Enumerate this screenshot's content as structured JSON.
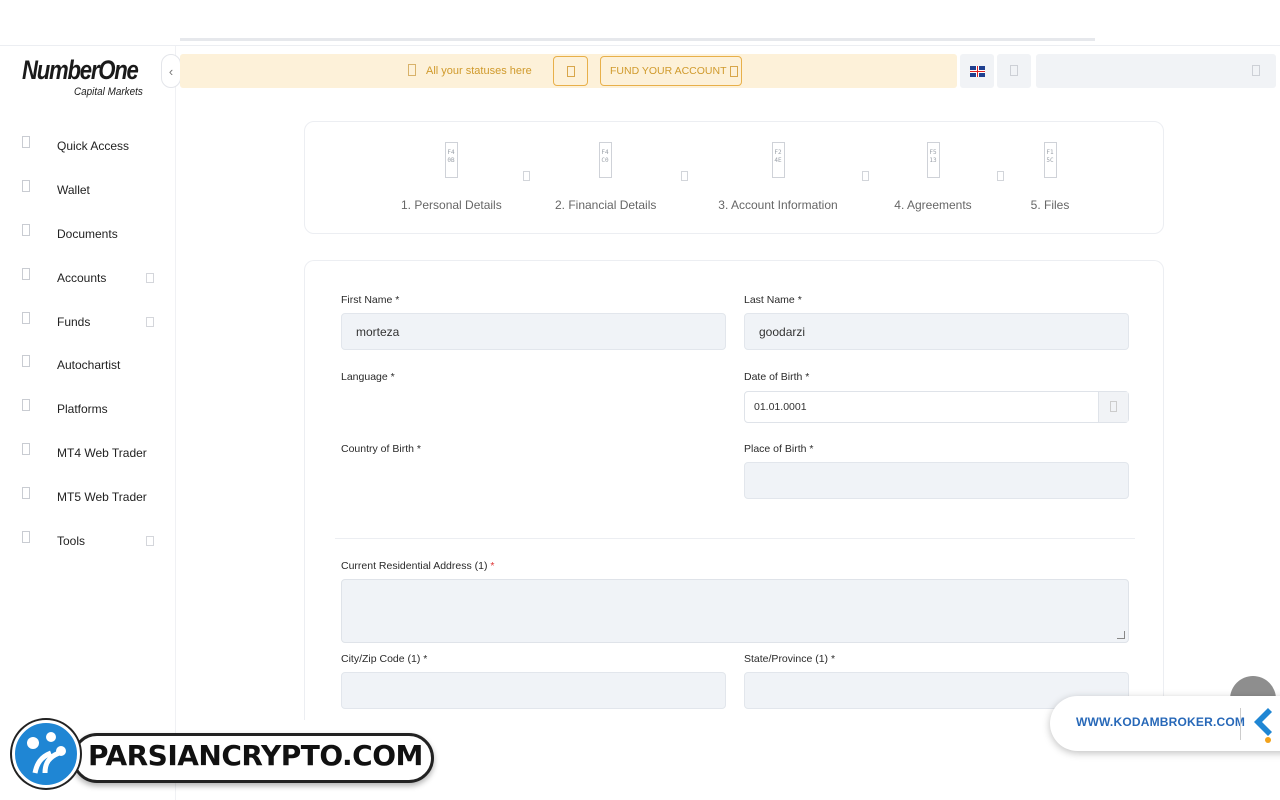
{
  "brand": {
    "logo_main": "NumberOne",
    "logo_sub": "Capital Markets"
  },
  "sidebar": {
    "items": [
      {
        "label": "Quick Access",
        "has_submenu": false
      },
      {
        "label": "Wallet",
        "has_submenu": false
      },
      {
        "label": "Documents",
        "has_submenu": false
      },
      {
        "label": "Accounts",
        "has_submenu": true
      },
      {
        "label": "Funds",
        "has_submenu": true
      },
      {
        "label": "Autochartist",
        "has_submenu": false
      },
      {
        "label": "Platforms",
        "has_submenu": false
      },
      {
        "label": "MT4 Web Trader",
        "has_submenu": false
      },
      {
        "label": "MT5 Web Trader",
        "has_submenu": false
      },
      {
        "label": "Tools",
        "has_submenu": true
      }
    ]
  },
  "topbar": {
    "status_text": "All your statuses here",
    "fund_button": "FUND YOUR ACCOUNT",
    "language_flag": "uk-flag-icon",
    "accent": "#d09a2c"
  },
  "stepper": {
    "steps": [
      {
        "label": "1. Personal Details",
        "icon_code": [
          "F4",
          "0B"
        ],
        "active": true
      },
      {
        "label": "2. Financial Details",
        "icon_code": [
          "F4",
          "C0"
        ],
        "active": false
      },
      {
        "label": "3. Account Information",
        "icon_code": [
          "F2",
          "4E"
        ],
        "active": false
      },
      {
        "label": "4. Agreements",
        "icon_code": [
          "F5",
          "13"
        ],
        "active": false
      },
      {
        "label": "5. Files",
        "icon_code": [
          "F1",
          "5C"
        ],
        "active": false
      }
    ],
    "active_color": "#3a8ad6"
  },
  "form": {
    "first_name": {
      "label": "First Name",
      "required": "*",
      "value": "morteza"
    },
    "last_name": {
      "label": "Last Name",
      "required": "*",
      "value": "goodarzi"
    },
    "language": {
      "label": "Language",
      "required": "*",
      "value": ""
    },
    "date_of_birth": {
      "label": "Date of Birth",
      "required": "*",
      "value": "01.01.0001"
    },
    "country_of_birth": {
      "label": "Country of Birth",
      "required": "*",
      "value": ""
    },
    "place_of_birth": {
      "label": "Place of Birth",
      "required": "*",
      "value": ""
    },
    "address": {
      "label": "Current Residential Address (1)",
      "required": "*",
      "value": ""
    },
    "city_zip": {
      "label": "City/Zip Code (1)",
      "required": "*",
      "value": ""
    },
    "state": {
      "label": "State/Province (1)",
      "required": "*",
      "value": ""
    }
  },
  "watermarks": {
    "kodam": "WWW.KODAMBROKER.COM",
    "parsian": "PARSIANCRYPTO.COM"
  }
}
